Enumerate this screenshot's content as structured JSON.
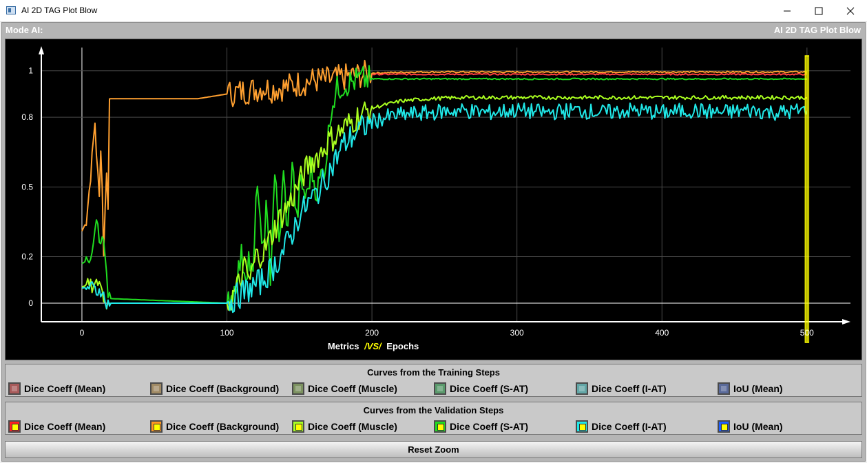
{
  "window": {
    "title": "AI 2D TAG Plot Blow"
  },
  "header": {
    "mode_label": "Mode AI:",
    "plot_title": "AI 2D TAG Plot Blow"
  },
  "xaxis": {
    "label_left": "Metrics",
    "label_vs": "/VS/",
    "label_right": "Epochs"
  },
  "legend_training": {
    "title": "Curves from the Training Steps",
    "items": [
      {
        "label": "Dice Coeff (Mean)",
        "color": "#a85a5a"
      },
      {
        "label": "Dice Coeff (Background)",
        "color": "#a08a64"
      },
      {
        "label": "Dice Coeff (Muscle)",
        "color": "#7c9260"
      },
      {
        "label": "Dice Coeff (S-AT)",
        "color": "#5a9a6c"
      },
      {
        "label": "Dice Coeff (I-AT)",
        "color": "#62a6a6"
      },
      {
        "label": "IoU (Mean)",
        "color": "#5a6a9a"
      }
    ]
  },
  "legend_validation": {
    "title": "Curves from the Validation Steps",
    "items": [
      {
        "label": "Dice Coeff (Mean)",
        "color": "#ff2020"
      },
      {
        "label": "Dice Coeff (Background)",
        "color": "#ff9a20"
      },
      {
        "label": "Dice Coeff (Muscle)",
        "color": "#aaff20"
      },
      {
        "label": "Dice Coeff (S-AT)",
        "color": "#20dd20"
      },
      {
        "label": "Dice Coeff (I-AT)",
        "color": "#20e8e8"
      },
      {
        "label": "IoU (Mean)",
        "color": "#2060ff"
      }
    ]
  },
  "reset_button": {
    "label": "Reset Zoom"
  },
  "chart_data": {
    "type": "line",
    "x_ticks": [
      "0",
      "100",
      "200",
      "300",
      "400",
      "500"
    ],
    "y_ticks": [
      "0",
      "0.2",
      "0.5",
      "0.8",
      "1"
    ],
    "xlim": [
      -28,
      530
    ],
    "ylim": [
      -0.08,
      1.1
    ],
    "grid": true,
    "marker_x": 500,
    "marker_color": "#ffff00",
    "series": [
      {
        "color": "#ffa030",
        "points": [
          [
            0,
            0.31
          ],
          [
            3,
            0.35
          ],
          [
            6,
            0.55
          ],
          [
            9,
            0.78
          ],
          [
            10,
            0.65
          ],
          [
            12,
            0.45
          ],
          [
            13,
            0.68
          ],
          [
            14,
            0.5
          ],
          [
            15,
            0.22
          ],
          [
            17,
            0.58
          ],
          [
            18,
            0.4
          ],
          [
            19,
            0.88
          ],
          [
            60,
            0.88
          ],
          [
            80,
            0.88
          ],
          [
            100,
            0.9
          ],
          [
            110,
            0.91
          ],
          [
            120,
            0.92
          ],
          [
            125,
            0.93
          ],
          [
            130,
            0.92
          ],
          [
            140,
            0.93
          ],
          [
            160,
            0.96
          ],
          [
            170,
            0.96
          ],
          [
            180,
            0.97
          ],
          [
            200,
            0.99
          ],
          [
            230,
            0.995
          ],
          [
            260,
            0.995
          ],
          [
            300,
            0.995
          ],
          [
            400,
            0.995
          ],
          [
            500,
            0.995
          ]
        ]
      },
      {
        "color": "#ff4040",
        "points": [
          [
            200,
            0.985
          ],
          [
            300,
            0.985
          ],
          [
            400,
            0.985
          ],
          [
            500,
            0.985
          ]
        ]
      },
      {
        "color": "#20dd20",
        "points": [
          [
            0,
            0.17
          ],
          [
            5,
            0.19
          ],
          [
            8,
            0.24
          ],
          [
            10,
            0.38
          ],
          [
            12,
            0.27
          ],
          [
            14,
            0.3
          ],
          [
            16,
            0.2
          ],
          [
            18,
            0.02
          ],
          [
            100,
            0.0
          ],
          [
            105,
            0.06
          ],
          [
            110,
            0.2
          ],
          [
            113,
            0.13
          ],
          [
            115,
            0.2
          ],
          [
            118,
            0.1
          ],
          [
            121,
            0.55
          ],
          [
            124,
            0.2
          ],
          [
            127,
            0.4
          ],
          [
            130,
            0.12
          ],
          [
            133,
            0.58
          ],
          [
            136,
            0.25
          ],
          [
            139,
            0.55
          ],
          [
            142,
            0.3
          ],
          [
            145,
            0.62
          ],
          [
            148,
            0.35
          ],
          [
            151,
            0.52
          ],
          [
            155,
            0.45
          ],
          [
            158,
            0.58
          ],
          [
            162,
            0.48
          ],
          [
            165,
            0.55
          ],
          [
            168,
            0.6
          ],
          [
            172,
            0.85
          ],
          [
            176,
            0.92
          ],
          [
            180,
            0.94
          ],
          [
            190,
            0.96
          ],
          [
            200,
            0.965
          ],
          [
            250,
            0.965
          ],
          [
            300,
            0.965
          ],
          [
            400,
            0.965
          ],
          [
            500,
            0.965
          ]
        ]
      },
      {
        "color": "#aaff20",
        "points": [
          [
            0,
            0.07
          ],
          [
            5,
            0.08
          ],
          [
            8,
            0.06
          ],
          [
            12,
            0.1
          ],
          [
            16,
            0.0
          ],
          [
            100,
            0.0
          ],
          [
            104,
            0.03
          ],
          [
            108,
            0.08
          ],
          [
            112,
            0.15
          ],
          [
            116,
            0.1
          ],
          [
            120,
            0.2
          ],
          [
            125,
            0.22
          ],
          [
            130,
            0.28
          ],
          [
            135,
            0.35
          ],
          [
            140,
            0.4
          ],
          [
            145,
            0.45
          ],
          [
            150,
            0.52
          ],
          [
            155,
            0.58
          ],
          [
            160,
            0.62
          ],
          [
            165,
            0.65
          ],
          [
            170,
            0.7
          ],
          [
            175,
            0.72
          ],
          [
            180,
            0.75
          ],
          [
            190,
            0.8
          ],
          [
            200,
            0.84
          ],
          [
            220,
            0.87
          ],
          [
            240,
            0.88
          ],
          [
            260,
            0.885
          ],
          [
            300,
            0.885
          ],
          [
            350,
            0.885
          ],
          [
            400,
            0.885
          ],
          [
            450,
            0.885
          ],
          [
            500,
            0.885
          ]
        ]
      },
      {
        "color": "#20e8e8",
        "points": [
          [
            0,
            0.065
          ],
          [
            5,
            0.07
          ],
          [
            8,
            0.065
          ],
          [
            10,
            0.05
          ],
          [
            14,
            0.06
          ],
          [
            16,
            0.0
          ],
          [
            100,
            0.0
          ],
          [
            105,
            0.02
          ],
          [
            110,
            0.04
          ],
          [
            115,
            0.06
          ],
          [
            120,
            0.08
          ],
          [
            125,
            0.1
          ],
          [
            130,
            0.14
          ],
          [
            135,
            0.18
          ],
          [
            140,
            0.24
          ],
          [
            145,
            0.3
          ],
          [
            150,
            0.38
          ],
          [
            155,
            0.42
          ],
          [
            160,
            0.46
          ],
          [
            165,
            0.5
          ],
          [
            170,
            0.56
          ],
          [
            175,
            0.62
          ],
          [
            180,
            0.68
          ],
          [
            190,
            0.74
          ],
          [
            200,
            0.78
          ],
          [
            210,
            0.8
          ],
          [
            220,
            0.81
          ],
          [
            240,
            0.82
          ],
          [
            260,
            0.83
          ],
          [
            280,
            0.82
          ],
          [
            300,
            0.83
          ],
          [
            320,
            0.82
          ],
          [
            340,
            0.83
          ],
          [
            360,
            0.82
          ],
          [
            380,
            0.83
          ],
          [
            400,
            0.82
          ],
          [
            420,
            0.83
          ],
          [
            440,
            0.82
          ],
          [
            460,
            0.83
          ],
          [
            480,
            0.82
          ],
          [
            500,
            0.83
          ]
        ]
      }
    ]
  }
}
